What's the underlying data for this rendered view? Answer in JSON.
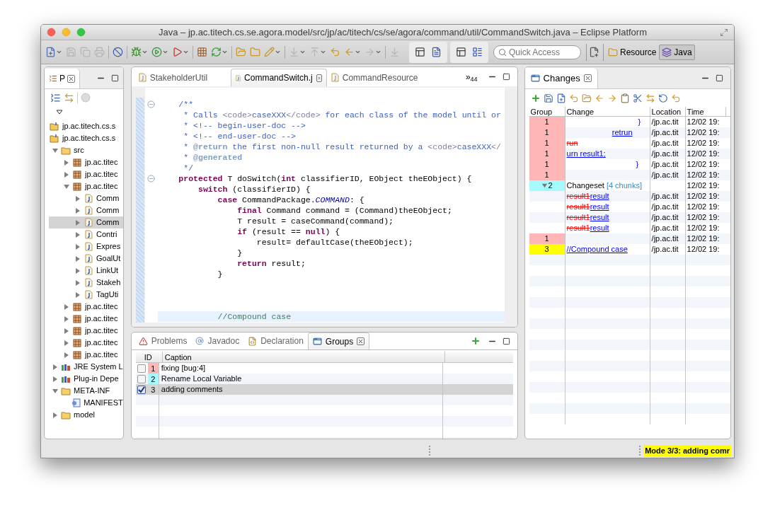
{
  "window": {
    "title": "Java – jp.ac.titech.cs.se.agora.model/src/jp/ac/titech/cs/se/agora/command/util/CommandSwitch.java – Eclipse Platform"
  },
  "toolbar": {
    "quick_access": {
      "placeholder": "Quick Access"
    },
    "perspectives": [
      {
        "label": "Resource",
        "kind": "resource",
        "selected": false
      },
      {
        "label": "Java",
        "kind": "java",
        "selected": true
      }
    ]
  },
  "package_explorer": {
    "tab": {
      "label": "P"
    },
    "tree": [
      {
        "label": "jp.ac.titech.cs.s",
        "kind": "project",
        "selected": false
      },
      {
        "label": "jp.ac.titech.cs.s",
        "kind": "project",
        "selected": false
      },
      {
        "label": "src",
        "kind": "source_folder",
        "expanded": true,
        "selected": false,
        "children": [
          {
            "label": "jp.ac.titec",
            "kind": "package",
            "expanded": false,
            "selected": false
          },
          {
            "label": "jp.ac.titec",
            "kind": "package",
            "expanded": false,
            "selected": false
          },
          {
            "label": "jp.ac.titec",
            "kind": "package",
            "expanded": true,
            "selected": false,
            "children": [
              {
                "label": "Comm",
                "kind": "java_file",
                "expanded": false,
                "selected": false
              },
              {
                "label": "Comm",
                "kind": "java_file",
                "expanded": false,
                "selected": false
              },
              {
                "label": "Comm",
                "kind": "java_file",
                "expanded": false,
                "selected": true
              },
              {
                "label": "Contri",
                "kind": "java_file",
                "expanded": false,
                "selected": false
              },
              {
                "label": "Expres",
                "kind": "java_file",
                "expanded": false,
                "selected": false
              },
              {
                "label": "GoalUt",
                "kind": "java_file",
                "expanded": false,
                "selected": false
              },
              {
                "label": "LinkUt",
                "kind": "java_file",
                "expanded": false,
                "selected": false
              },
              {
                "label": "Stakeh",
                "kind": "java_file",
                "expanded": false,
                "selected": false
              },
              {
                "label": "TagUti",
                "kind": "java_file",
                "expanded": false,
                "selected": false
              }
            ]
          },
          {
            "label": "jp.ac.titec",
            "kind": "package",
            "expanded": false,
            "selected": false
          },
          {
            "label": "jp.ac.titec",
            "kind": "package",
            "expanded": false,
            "selected": false
          },
          {
            "label": "jp.ac.titec",
            "kind": "package",
            "expanded": false,
            "selected": false
          },
          {
            "label": "jp.ac.titec",
            "kind": "package",
            "expanded": false,
            "selected": false
          },
          {
            "label": "jp.ac.titec",
            "kind": "package",
            "expanded": false,
            "selected": false
          }
        ]
      },
      {
        "label": "JRE System L",
        "kind": "library",
        "expanded": false,
        "selected": false
      },
      {
        "label": "Plug-in Depe",
        "kind": "library",
        "expanded": false,
        "selected": false
      },
      {
        "label": "META-INF",
        "kind": "folder",
        "expanded": true,
        "selected": false,
        "children": [
          {
            "label": "MANIFEST",
            "kind": "manifest",
            "selected": false
          }
        ]
      },
      {
        "label": "model",
        "kind": "folder",
        "expanded": false,
        "selected": false
      }
    ]
  },
  "editor": {
    "tabs": [
      {
        "label": "StakeholderUtil",
        "selected": false
      },
      {
        "label": "CommandSwitch.j",
        "selected": true
      },
      {
        "label": "CommandResource",
        "selected": false
      }
    ],
    "overflow": {
      "mark": "»",
      "count": "44"
    },
    "lines": [
      {
        "fold": false,
        "current": false
      },
      {
        "fold": true,
        "current": false,
        "tokens": [
          {
            "text": "    /**",
            "kind": "javadoc"
          }
        ]
      },
      {
        "fold": false,
        "current": false,
        "tokens": [
          {
            "text": "     * Calls ",
            "kind": "javadoc"
          },
          {
            "text": "<code>",
            "kind": "html"
          },
          {
            "text": "caseXXX",
            "kind": "javadoc"
          },
          {
            "text": "</code>",
            "kind": "html"
          },
          {
            "text": " for each class of the model until or",
            "kind": "javadoc"
          }
        ]
      },
      {
        "fold": false,
        "current": false,
        "tokens": [
          {
            "text": "     * <!-- begin-user-doc -->",
            "kind": "javadoc"
          }
        ]
      },
      {
        "fold": false,
        "current": false,
        "tokens": [
          {
            "text": "     * <!-- end-user-doc -->",
            "kind": "javadoc"
          }
        ]
      },
      {
        "fold": false,
        "current": false,
        "tokens": [
          {
            "text": "     * ",
            "kind": "javadoc"
          },
          {
            "text": "@return",
            "kind": "tag"
          },
          {
            "text": " the first non-null result returned by a ",
            "kind": "javadoc"
          },
          {
            "text": "<code>",
            "kind": "html"
          },
          {
            "text": "caseXXX",
            "kind": "javadoc"
          },
          {
            "text": "</",
            "kind": "html"
          }
        ]
      },
      {
        "fold": false,
        "current": false,
        "tokens": [
          {
            "text": "     * ",
            "kind": "javadoc"
          },
          {
            "text": "@generated",
            "kind": "tag"
          }
        ]
      },
      {
        "fold": false,
        "current": false,
        "tokens": [
          {
            "text": "     */",
            "kind": "javadoc"
          }
        ]
      },
      {
        "fold": true,
        "current": false,
        "tokens": [
          {
            "text": "    protected",
            "kind": "keyword"
          },
          {
            "text": " T doSwitch(",
            "kind": "plain"
          },
          {
            "text": "int",
            "kind": "keyword"
          },
          {
            "text": " classifierID, EObject theEObject) {",
            "kind": "plain"
          }
        ]
      },
      {
        "fold": false,
        "current": false,
        "tokens": [
          {
            "text": "        switch",
            "kind": "keyword"
          },
          {
            "text": " (classifierID) {",
            "kind": "plain"
          }
        ]
      },
      {
        "fold": false,
        "current": false,
        "tokens": [
          {
            "text": "            case",
            "kind": "keyword"
          },
          {
            "text": " CommandPackage.",
            "kind": "plain"
          },
          {
            "text": "COMMAND",
            "kind": "constant"
          },
          {
            "text": ": {",
            "kind": "plain"
          }
        ]
      },
      {
        "fold": false,
        "current": false,
        "tokens": [
          {
            "text": "                final",
            "kind": "keyword"
          },
          {
            "text": " Command command = (Command)theEObject;",
            "kind": "plain"
          }
        ]
      },
      {
        "fold": false,
        "current": false,
        "tokens": [
          {
            "text": "                T result = caseCommand(command);",
            "kind": "plain"
          }
        ]
      },
      {
        "fold": false,
        "current": false,
        "tokens": [
          {
            "text": "                if",
            "kind": "keyword"
          },
          {
            "text": " (result == ",
            "kind": "plain"
          },
          {
            "text": "null",
            "kind": "keyword"
          },
          {
            "text": ") {",
            "kind": "plain"
          }
        ]
      },
      {
        "fold": false,
        "current": false,
        "tokens": [
          {
            "text": "                    result= defaultCase(theEObject);",
            "kind": "plain"
          }
        ]
      },
      {
        "fold": false,
        "current": false,
        "tokens": [
          {
            "text": "                }",
            "kind": "plain"
          }
        ]
      },
      {
        "fold": false,
        "current": false,
        "tokens": [
          {
            "text": "                return",
            "kind": "keyword"
          },
          {
            "text": " result;",
            "kind": "plain"
          }
        ]
      },
      {
        "fold": false,
        "current": false,
        "tokens": [
          {
            "text": "            }",
            "kind": "plain"
          }
        ]
      },
      {
        "fold": false,
        "current": false
      },
      {
        "fold": false,
        "current": false
      },
      {
        "fold": false,
        "current": false
      },
      {
        "fold": false,
        "current": true,
        "tokens": [
          {
            "text": "            //Compound case",
            "kind": "comment"
          }
        ]
      }
    ]
  },
  "bottom_panel": {
    "tabs": [
      {
        "label": "Problems",
        "kind": "problems",
        "selected": false
      },
      {
        "label": "Javadoc",
        "kind": "javadoc",
        "selected": false
      },
      {
        "label": "Declaration",
        "kind": "declaration",
        "selected": false
      },
      {
        "label": "Groups",
        "kind": "groups",
        "selected": true
      }
    ],
    "columns": [
      "ID",
      "Caption"
    ],
    "rows": [
      {
        "checked": false,
        "id": "1",
        "color": "#ffb6b6",
        "caption": "fixing [bug:4]",
        "selected": false
      },
      {
        "checked": false,
        "id": "2",
        "color": "#a6fbff",
        "caption": "Rename Local Variable",
        "selected": false
      },
      {
        "checked": true,
        "id": "3",
        "caption": "adding comments",
        "selected": true
      }
    ]
  },
  "changes_view": {
    "tab": {
      "label": "Changes"
    },
    "columns": [
      "Group",
      "Change",
      "Location",
      "Time"
    ],
    "rows": [
      {
        "kind": "change",
        "group": "1",
        "color": "#ffb6b6",
        "change": [
          {
            "text": "                                 }",
            "kind": "added"
          }
        ],
        "location": "/jp.ac.tit",
        "time": "12/02 19:"
      },
      {
        "kind": "change",
        "group": "1",
        "color": "#ffb6b6",
        "change": [
          {
            "text": "                     retrun",
            "kind": "added"
          }
        ],
        "location": "/jp.ac.tit",
        "time": "12/02 19:"
      },
      {
        "kind": "change",
        "group": "1",
        "color": "#ffb6b6",
        "change": [
          {
            "text": "run",
            "kind": "deleted"
          }
        ],
        "location": "/jp.ac.tit",
        "time": "12/02 19:"
      },
      {
        "kind": "change",
        "group": "1",
        "color": "#ffb6b6",
        "change": [
          {
            "text": "urn result1;",
            "kind": "added"
          }
        ],
        "location": "/jp.ac.tit",
        "time": "12/02 19:"
      },
      {
        "kind": "change",
        "group": "1",
        "color": "#ffb6b6",
        "change": [
          {
            "text": "                                }",
            "kind": "added"
          }
        ],
        "location": "/jp.ac.tit",
        "time": "12/02 19:"
      },
      {
        "kind": "change",
        "group": "1",
        "color": "#ffb6b6",
        "location": "/jp.ac.tit",
        "time": "12/02 19:"
      },
      {
        "kind": "changeset",
        "group": "2",
        "color": "#a6fbff",
        "expanded": true,
        "label": "Changeset",
        "chunks": "[4 chunks]",
        "time": "12/02 19:"
      },
      {
        "kind": "change",
        "change": [
          {
            "text": "result1",
            "kind": "deleted"
          },
          {
            "text": "result",
            "kind": "added"
          }
        ],
        "location": "/jp.ac.tit",
        "time": "12/02 19:"
      },
      {
        "kind": "change",
        "change": [
          {
            "text": "result1",
            "kind": "deleted"
          },
          {
            "text": "result",
            "kind": "added"
          }
        ],
        "location": "/jp.ac.tit",
        "time": "12/02 19:"
      },
      {
        "kind": "change",
        "change": [
          {
            "text": "result1",
            "kind": "deleted"
          },
          {
            "text": "result",
            "kind": "added"
          }
        ],
        "location": "/jp.ac.tit",
        "time": "12/02 19:"
      },
      {
        "kind": "change",
        "change": [
          {
            "text": "result1",
            "kind": "deleted"
          },
          {
            "text": "result",
            "kind": "added"
          }
        ],
        "location": "/jp.ac.tit",
        "time": "12/02 19:"
      },
      {
        "kind": "change",
        "group": "1",
        "color": "#ffb6b6",
        "location": "/jp.ac.tit",
        "time": "12/02 19:"
      },
      {
        "kind": "change",
        "group": "3",
        "color": "#ffff00",
        "change": [
          {
            "text": "//Compound case",
            "kind": "added"
          }
        ],
        "location": "/jp.ac.tit",
        "time": "12/02 19:"
      }
    ]
  },
  "status_bar": {
    "mode": "Mode 3/3: adding comr"
  }
}
